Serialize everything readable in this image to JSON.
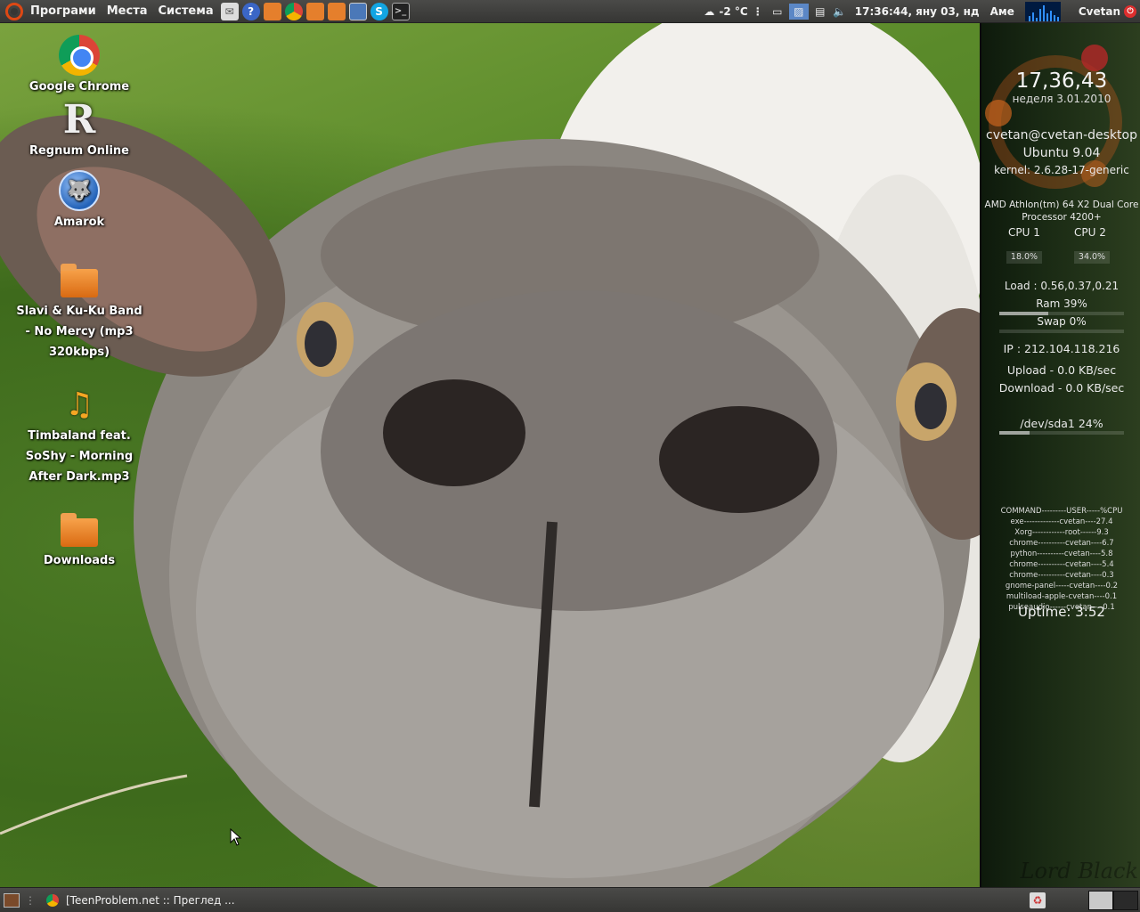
{
  "top_panel": {
    "menus": [
      "Програми",
      "Места",
      "Система"
    ],
    "launchers": [
      "mail-icon",
      "help-icon",
      "home-folder-icon",
      "chrome-icon",
      "home-folder-icon",
      "folder-icon",
      "file-manager-icon",
      "skype-icon",
      "terminal-icon"
    ],
    "weather": {
      "icon": "cloud-snow-icon",
      "temp": "-2 °C"
    },
    "clock": "17:36:44, яну 03, нд",
    "keyboard": "Аме",
    "user": "Cvetan"
  },
  "desktop": {
    "icons": [
      {
        "name": "chrome",
        "label": "Google Chrome"
      },
      {
        "name": "regnum",
        "label": "Regnum Online"
      },
      {
        "name": "amarok",
        "label": "Amarok"
      },
      {
        "name": "folder-slavi",
        "label": "Slavi & Ku-Ku Band - No Mercy (mp3 320kbps)"
      },
      {
        "name": "music-timbaland",
        "label": "Timbaland feat. SoShy - Morning After Dark.mp3"
      },
      {
        "name": "downloads",
        "label": "Downloads"
      }
    ]
  },
  "conky": {
    "time": "17,36,43",
    "date": "неделя  3.01.2010",
    "user_host": "cvetan@cvetan-desktop",
    "os": "Ubuntu 9.04",
    "kernel": "kernel: 2.6.28-17-generic",
    "cpu_model": "AMD Athlon(tm) 64 X2 Dual Core Processor 4200+",
    "cpu1_label": "CPU 1",
    "cpu2_label": "CPU 2",
    "cpu1_value": "18.0%",
    "cpu2_value": "34.0%",
    "load": "Load : 0.56,0.37,0.21",
    "ram": "Ram 39%",
    "ram_fraction": 0.39,
    "swap": "Swap 0%",
    "swap_fraction": 0.0,
    "ip": "IP : 212.104.118.216",
    "upload": "Upload - 0.0 KB/sec",
    "download": "Download - 0.0 KB/sec",
    "disk": "/dev/sda1 24%",
    "disk_fraction": 0.24,
    "processes": [
      "COMMAND---------USER-----%CPU",
      "exe-------------cvetan----27.4",
      "Xorg------------root------9.3",
      "chrome----------cvetan----6.7",
      "python----------cvetan----5.8",
      "chrome----------cvetan----5.4",
      "chrome----------cvetan----0.3",
      "gnome-panel-----cvetan----0.2",
      "multiload-apple-cvetan----0.1",
      "pulseaudio------cvetan----0.1"
    ],
    "uptime": "Uptime: 3:52"
  },
  "bottom_panel": {
    "task_title": "[TeenProblem.net :: Преглед ..."
  }
}
